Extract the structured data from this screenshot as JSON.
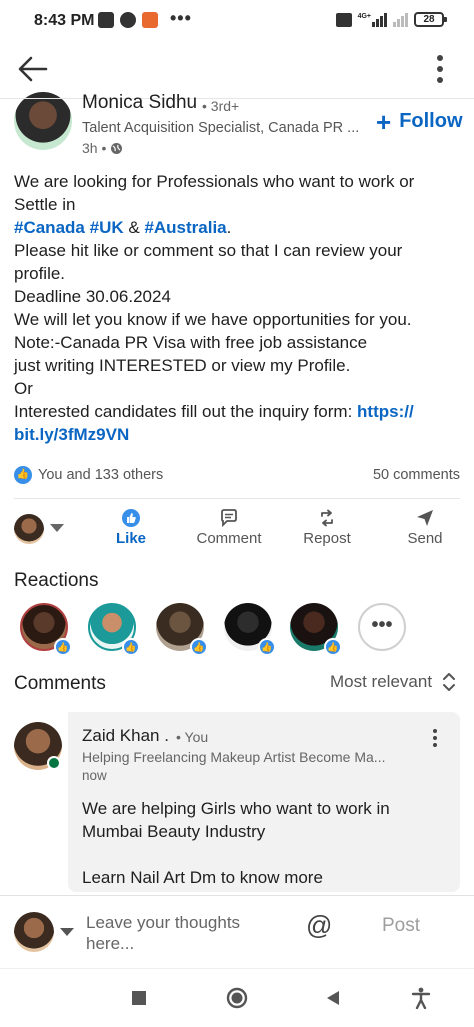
{
  "status_bar": {
    "time": "8:43 PM",
    "battery": "28",
    "icons": [
      "photo-icon",
      "facebook-icon",
      "app-icon",
      "more-notifications-icon",
      "volte-icon",
      "signal-icon",
      "battery-icon"
    ],
    "network": "4G+"
  },
  "app_bar": {
    "icons": [
      "back-arrow-icon",
      "overflow-menu-icon"
    ]
  },
  "post": {
    "author": "Monica Sidhu",
    "degree": "• 3rd+",
    "headline": "Talent Acquisition Specialist, Canada PR ...",
    "time": "3h •",
    "follow_label": "Follow",
    "body": {
      "l1": "We are looking for Professionals who want to work or",
      "l2": "Settle in",
      "tag1": "#Canada",
      "tag2": "#UK",
      "amp": "&",
      "tag3": "#Australia",
      "period": ".",
      "l4": "Please hit like or comment so that I can review your",
      "l5": "profile.",
      "l6": "Deadline 30.06.2024",
      "l7": "We will let you know if we have opportunities for you.",
      "l8": "Note:-Canada PR Visa with free job assistance",
      "l9": "just writing INTERESTED or view my Profile.",
      "l10": "Or",
      "l11": "Interested candidates fill out the inquiry form:",
      "link1": "https://",
      "link2": "bit.ly/3fMz9VN"
    },
    "likes_text": "You and 133 others",
    "comments_count": "50 comments"
  },
  "actions": {
    "like": "Like",
    "comment": "Comment",
    "repost": "Repost",
    "send": "Send"
  },
  "reactions": {
    "title": "Reactions",
    "avatar_colors": [
      "#5a3a2a",
      "#c98f6a",
      "#6b5540",
      "#2d2d2d",
      "#4a2a1e"
    ],
    "ring_colors": [
      "#b04040",
      "#1c9a9a",
      "#777777",
      "#777777",
      "#1a7a6a"
    ]
  },
  "comments": {
    "title": "Comments",
    "sort_label": "Most relevant",
    "items": [
      {
        "name": "Zaid Khan .",
        "badge": "• You",
        "headline": "Helping Freelancing Makeup Artist Become Ma...",
        "time": "now",
        "line1": "We are helping Girls who want to work in",
        "line2": "Mumbai Beauty Industry",
        "line3": "Learn Nail Art Dm to know more"
      }
    ]
  },
  "composer": {
    "placeholder": "Leave your thoughts here...",
    "mention_symbol": "@",
    "post_label": "Post"
  },
  "accent_color": "#0a66c2",
  "system_nav": [
    "recents-square-icon",
    "home-circle-icon",
    "back-triangle-icon",
    "accessibility-icon"
  ]
}
